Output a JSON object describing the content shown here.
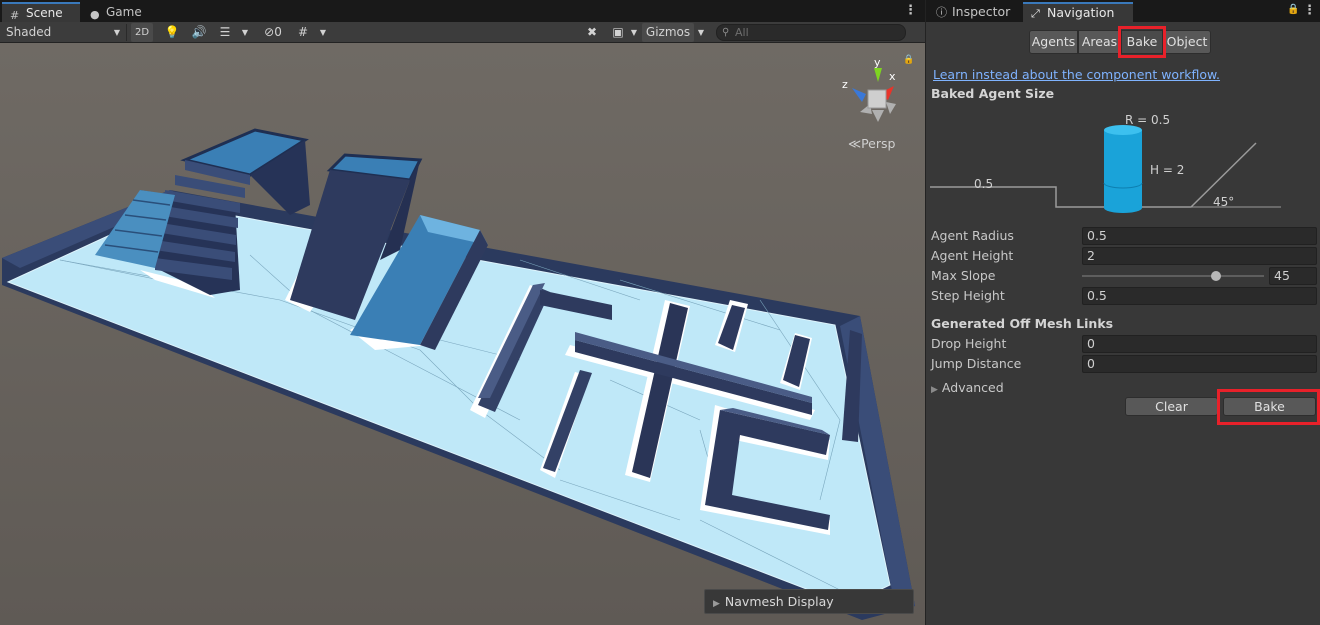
{
  "scene_tabs": [
    {
      "label": "Scene",
      "icon": "grid-icon",
      "active": true
    },
    {
      "label": "Game",
      "icon": "gamepad-icon",
      "active": false
    }
  ],
  "scene_toolbar": {
    "shading_mode": "Shaded",
    "mode_2d": "2D",
    "hidden_count": "0",
    "gizmos": "Gizmos",
    "search_placeholder": "All"
  },
  "gizmo": {
    "projection": "Persp",
    "axis_y": "y",
    "axis_x": "x",
    "axis_z": "z"
  },
  "navmesh_display": "Navmesh Display",
  "nav_tabs": [
    {
      "label": "Inspector",
      "icon": "info-icon",
      "active": false
    },
    {
      "label": "Navigation",
      "icon": "navigation-icon",
      "active": true
    }
  ],
  "nav_sections": [
    "Agents",
    "Areas",
    "Bake",
    "Object"
  ],
  "nav_active_section": "Bake",
  "workflow_link": "Learn instead about the component workflow.",
  "baked_agent_size": {
    "title": "Baked Agent Size",
    "radius_label": "R = 0.5",
    "height_label": "H = 2",
    "step_label": "0.5",
    "slope_label": "45°"
  },
  "agent_fields": [
    {
      "label": "Agent Radius",
      "value": "0.5"
    },
    {
      "label": "Agent Height",
      "value": "2"
    },
    {
      "label": "Max Slope",
      "value": "45",
      "slider_fraction": 0.75
    },
    {
      "label": "Step Height",
      "value": "0.5"
    }
  ],
  "off_mesh": {
    "title": "Generated Off Mesh Links",
    "fields": [
      {
        "label": "Drop Height",
        "value": "0"
      },
      {
        "label": "Jump Distance",
        "value": "0"
      }
    ]
  },
  "advanced_label": "Advanced",
  "buttons": {
    "clear": "Clear",
    "bake": "Bake"
  },
  "colors": {
    "highlight": "#e8212a",
    "navmesh": "#a8dcf2",
    "agent_cylinder": "#1aa3d9",
    "link": "#7fb3ff",
    "active_tab_accent": "#3a79bb"
  }
}
